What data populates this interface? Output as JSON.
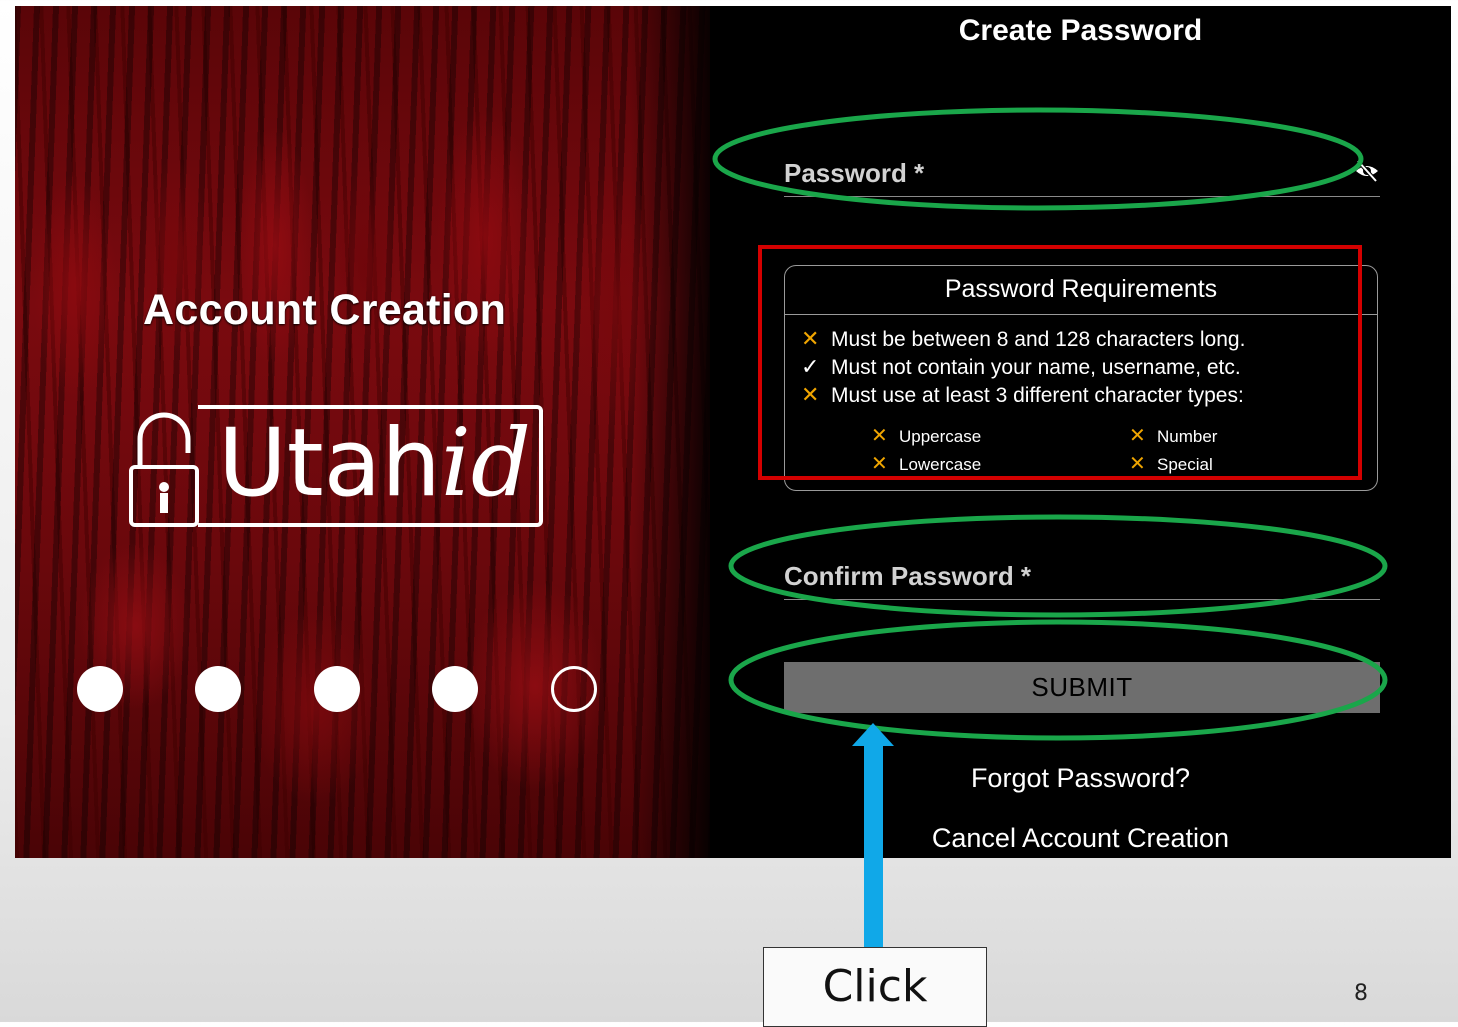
{
  "left_panel": {
    "title": "Account Creation",
    "logo": {
      "text_main": "Utah",
      "text_italic": "id"
    },
    "progress": {
      "total_steps": 5,
      "completed_steps": 4
    }
  },
  "form": {
    "title": "Create Password",
    "password_label": "Password *",
    "requirements": {
      "title": "Password Requirements",
      "items": [
        {
          "mark": "✕",
          "status": "fail",
          "text": "Must be between 8 and 128 characters long."
        },
        {
          "mark": "✓",
          "status": "pass",
          "text": "Must not contain your name, username, etc."
        },
        {
          "mark": "✕",
          "status": "fail",
          "text": "Must use at least 3 different character types:"
        }
      ],
      "char_types": [
        {
          "mark": "✕",
          "status": "fail",
          "text": "Uppercase"
        },
        {
          "mark": "✕",
          "status": "fail",
          "text": "Number"
        },
        {
          "mark": "✕",
          "status": "fail",
          "text": "Lowercase"
        },
        {
          "mark": "✕",
          "status": "fail",
          "text": "Special"
        }
      ]
    },
    "confirm_label": "Confirm Password *",
    "submit_label": "SUBMIT",
    "forgot_link": "Forgot Password?",
    "cancel_link": "Cancel Account Creation"
  },
  "annotations": {
    "click_label": "Click",
    "page_number": "8",
    "colors": {
      "highlight_green": "#1aa64a",
      "highlight_red": "#d40000",
      "arrow_blue": "#10a8e8"
    }
  },
  "icons": [
    "eye-slash-icon",
    "lock-icon",
    "x-icon",
    "check-icon"
  ]
}
